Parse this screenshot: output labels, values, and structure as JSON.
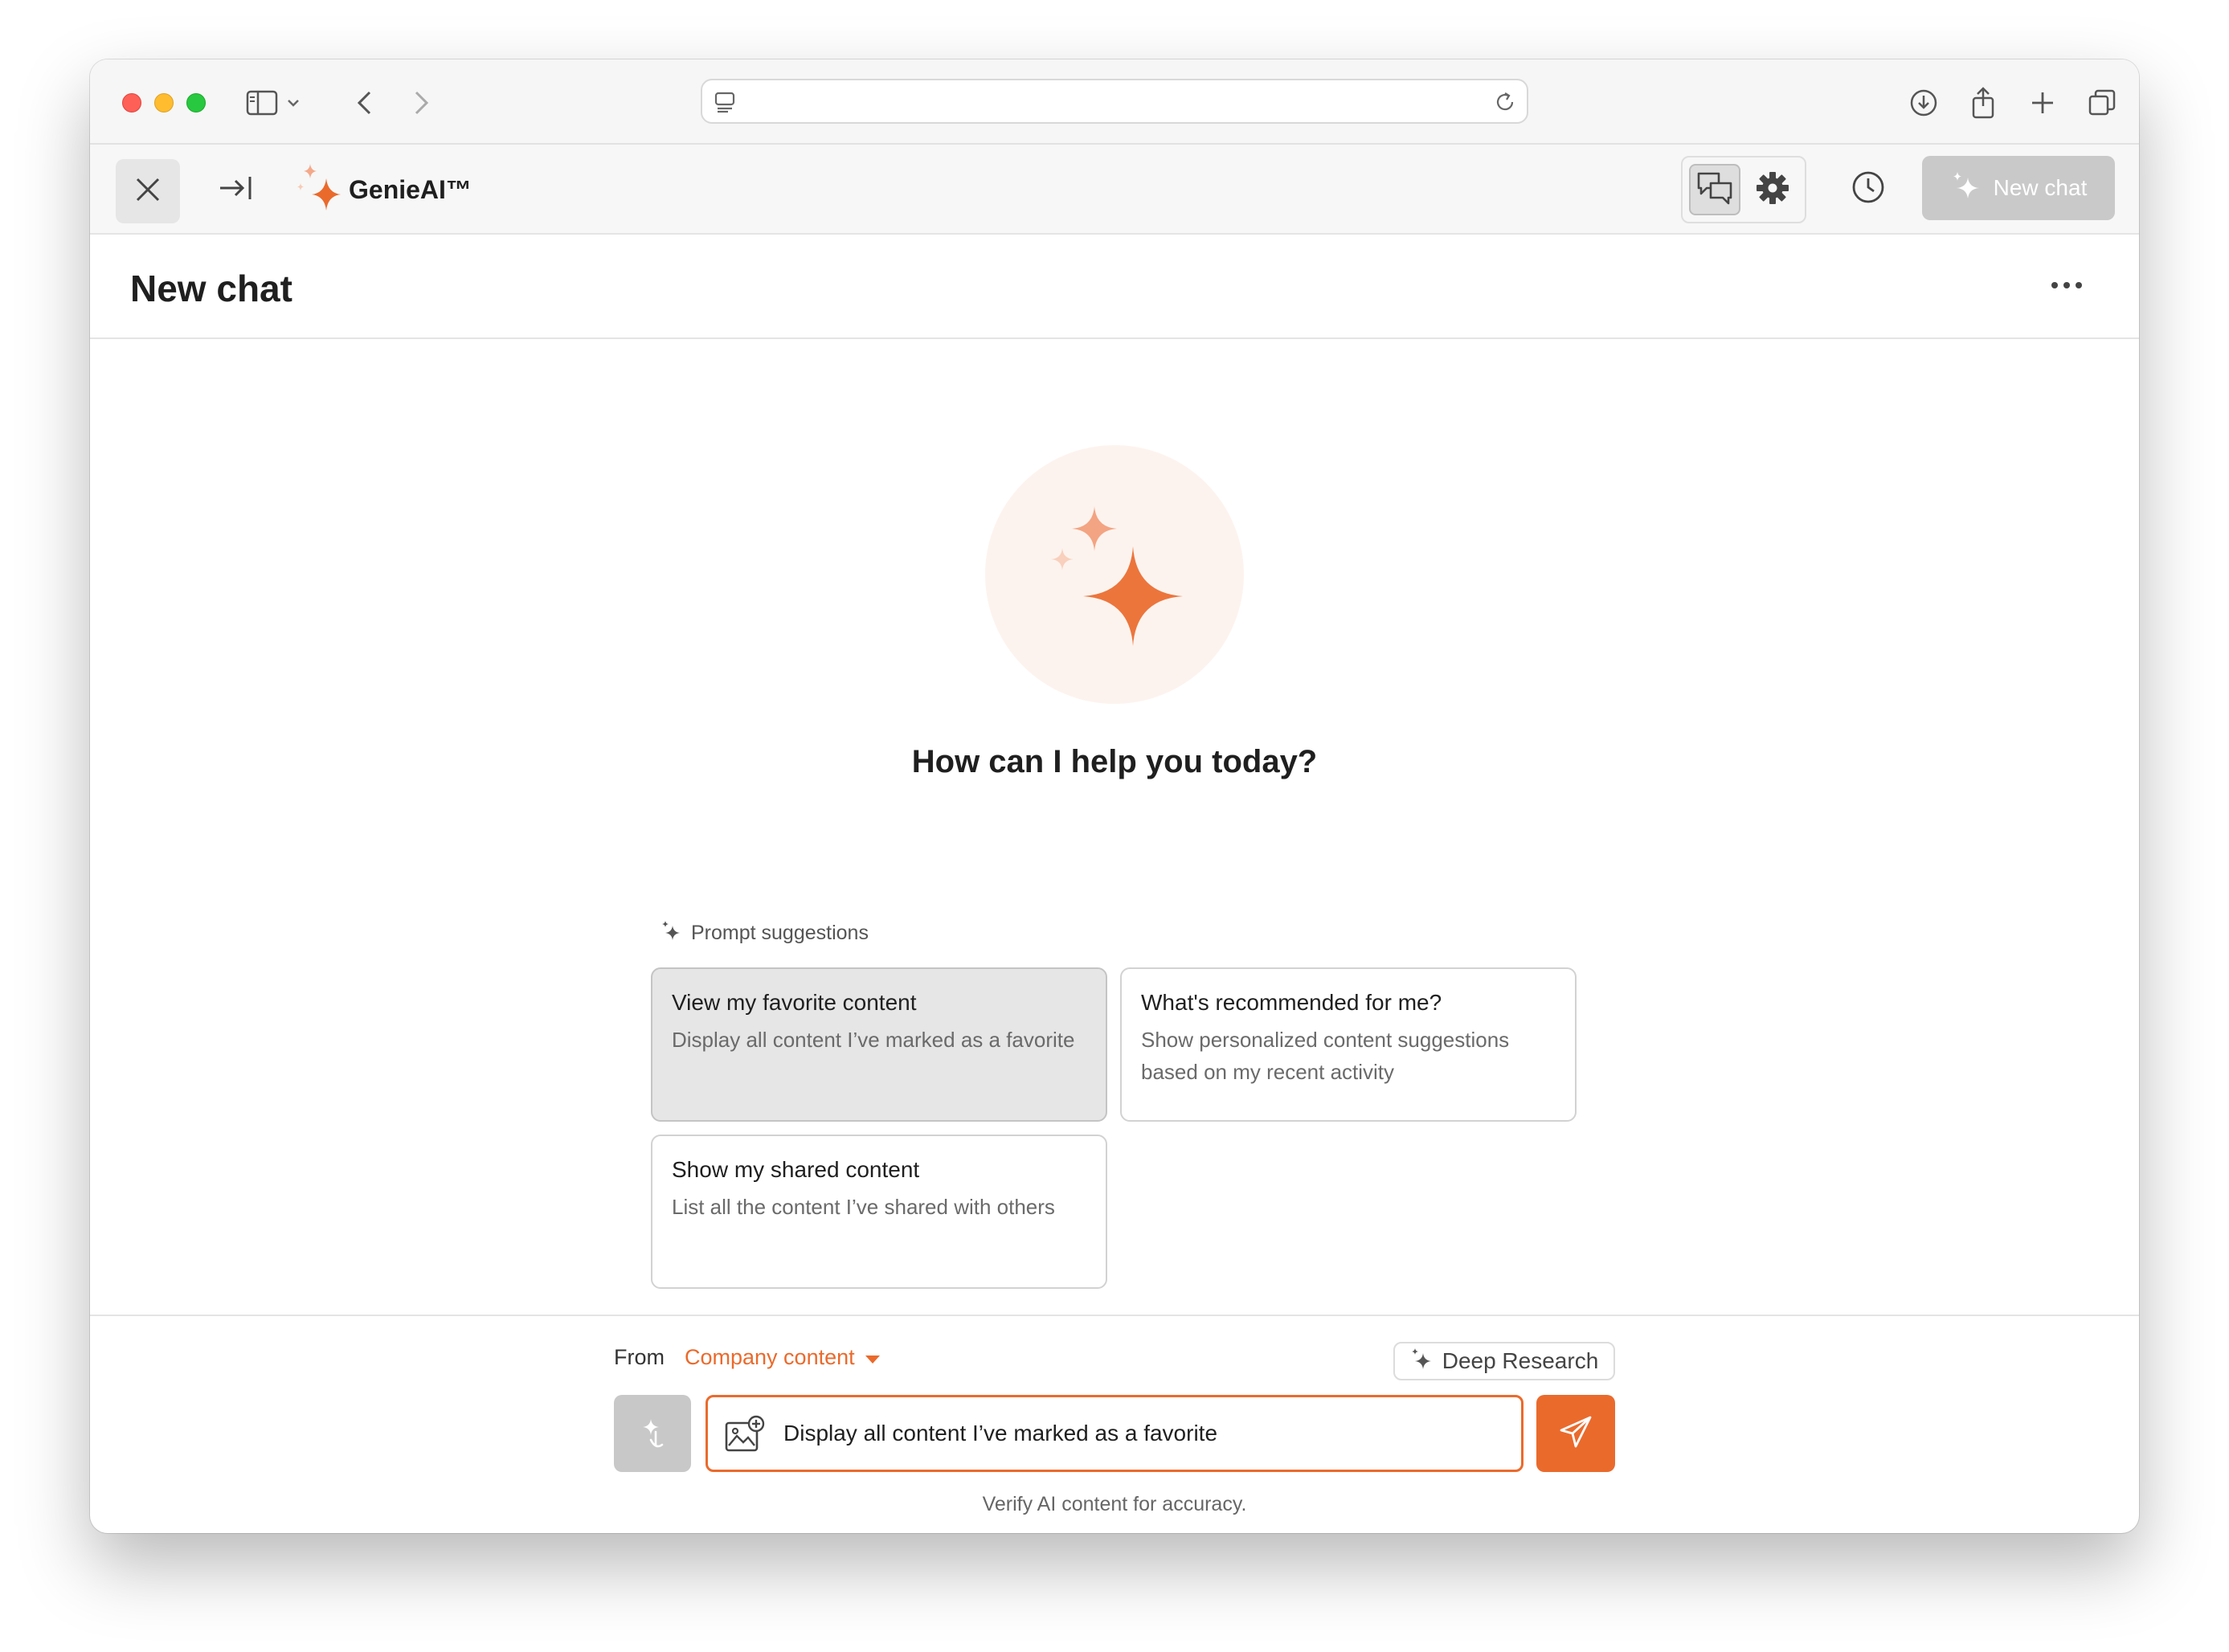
{
  "browser": {
    "icons": [
      "sidebar-icon",
      "chevron-down-icon",
      "back-icon",
      "forward-icon",
      "page-icon",
      "reload-icon",
      "download-icon",
      "share-icon",
      "plus-icon",
      "tabs-icon"
    ]
  },
  "header": {
    "brand_name": "GenieAI™",
    "new_chat_label": "New chat",
    "icons": [
      "close-icon",
      "collapse-icon",
      "chat-bubbles-icon",
      "gear-icon",
      "clock-icon",
      "sparkle-icon"
    ]
  },
  "page": {
    "title": "New chat",
    "hero_text": "How can I help you today?"
  },
  "suggestions": {
    "label": "Prompt suggestions",
    "items": [
      {
        "title": "View my favorite content",
        "desc": "Display all content I’ve marked as a favorite",
        "selected": true
      },
      {
        "title": "What's recommended for me?",
        "desc": "Show personalized content suggestions based on my recent activity",
        "selected": false
      },
      {
        "title": "Show my shared content",
        "desc": "List all the content I’ve shared with others",
        "selected": false
      }
    ]
  },
  "composer": {
    "from_label": "From",
    "source": "Company content",
    "deep_research_label": "Deep Research",
    "input_value": "Display all content I’ve marked as a favorite",
    "disclaimer": "Verify AI content for accuracy."
  },
  "colors": {
    "accent": "#ea6a2c",
    "hero_bg": "#fdf3ee",
    "disabled": "#c9c9c9"
  }
}
